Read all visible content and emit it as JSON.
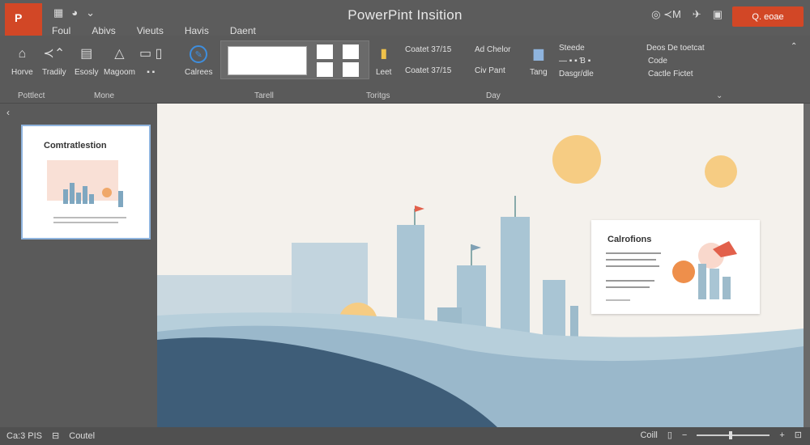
{
  "window": {
    "title": "PowerPint Insition",
    "app_letter": "P"
  },
  "tabs": [
    "Foul",
    "Abivs",
    "Vieuts",
    "Havis",
    "Daent"
  ],
  "share": {
    "label": "Q. eoae"
  },
  "ribbon": {
    "buttons": [
      {
        "icon": "home-icon",
        "label": "Horve"
      },
      {
        "icon": "undo-icon",
        "label": "Tradily"
      },
      {
        "icon": "clipboard-icon",
        "label": "Esosly"
      },
      {
        "icon": "shapes-icon",
        "label": "Magoom"
      },
      {
        "icon": "box-icon",
        "label": ""
      },
      {
        "icon": "pin-icon",
        "label": "Calrees"
      }
    ],
    "texts": {
      "leet": "Leet",
      "tang": "Tang",
      "chart1": "Coatet 37/15",
      "chart2": "Coatet 37/15",
      "ad_chelor": "Ad Chelor",
      "civ_pant": "Civ Pant",
      "steede": "Steede",
      "dasgr": "Dasgr/dle",
      "deos_title": "Deos De toetcat",
      "deos_code": "Code",
      "cactle": "Cactle Fictet"
    },
    "groups": [
      "Pottlect",
      "Mone",
      "Tarell",
      "Toritgs",
      "Day"
    ]
  },
  "thumbnail": {
    "title": "Comtratlestion"
  },
  "main_slide": {
    "card_title": "Calrofions"
  },
  "status": {
    "slide": "Ca:3 PIS",
    "notes": "Coutel",
    "view": "Coill"
  },
  "colors": {
    "accent": "#d24726",
    "sun": "#f6cc83",
    "sky": "#f4f1ec",
    "building": "#a9c5d4",
    "ground_dark": "#3e5d78",
    "ground_light": "#9ab8cb",
    "selection": "#8fb4de"
  }
}
